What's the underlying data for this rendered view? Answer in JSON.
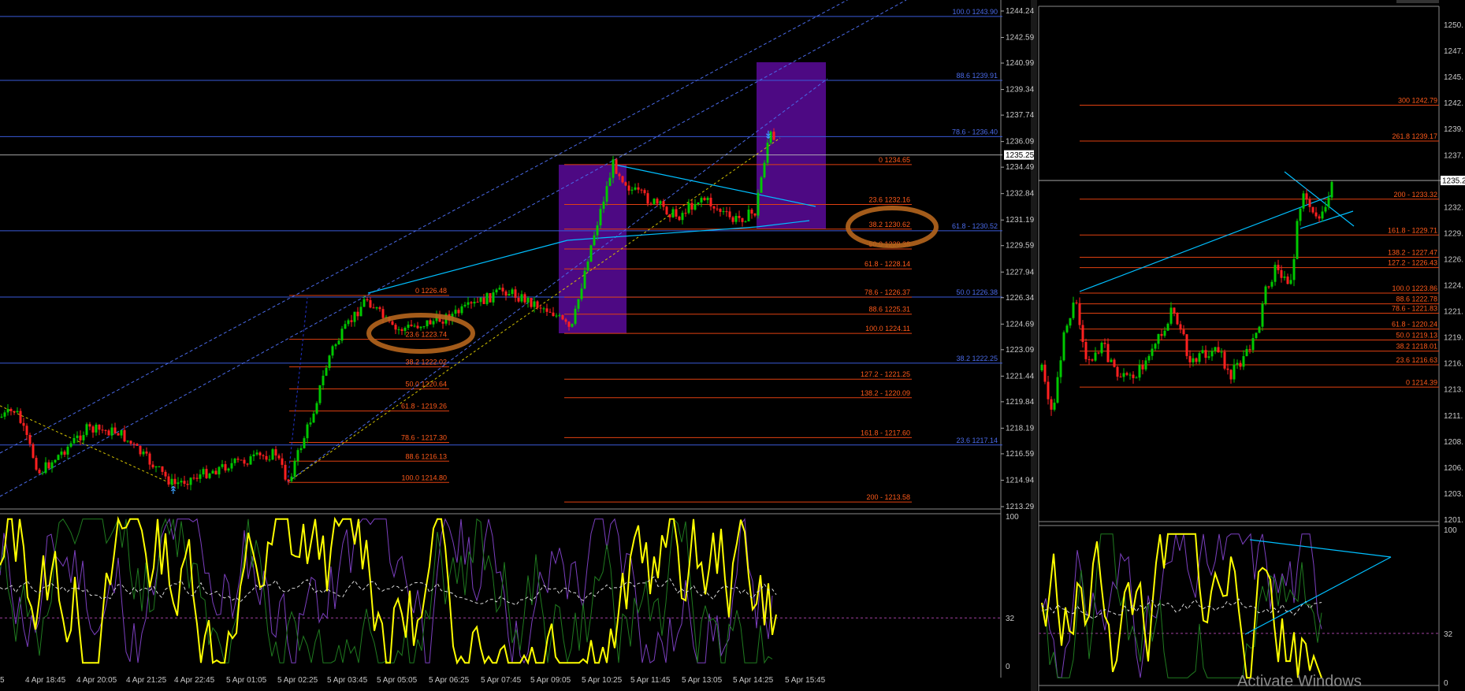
{
  "chart_data": [
    {
      "type": "candlestick",
      "panel": "main-left",
      "y_axis_ticks": [
        "1244.24",
        "1242.59",
        "1240.99",
        "1239.34",
        "1237.74",
        "1236.09",
        "1234.49",
        "1232.84",
        "1231.19",
        "1229.59",
        "1227.94",
        "1226.34",
        "1224.69",
        "1223.09",
        "1221.44",
        "1219.84",
        "1218.19",
        "1216.59",
        "1214.94",
        "1213.29"
      ],
      "ylim": [
        1213.29,
        1244.24
      ],
      "current_price": "1235.25",
      "x_axis_ticks": [
        "5",
        "4 Apr 18:45",
        "4 Apr 20:05",
        "4 Apr 21:25",
        "4 Apr 22:45",
        "5 Apr 01:05",
        "5 Apr 02:25",
        "5 Apr 03:45",
        "5 Apr 05:05",
        "5 Apr 06:25",
        "5 Apr 07:45",
        "5 Apr 09:05",
        "5 Apr 10:25",
        "5 Apr 11:45",
        "5 Apr 13:05",
        "5 Apr 14:25",
        "5 Apr 15:45"
      ],
      "blue_fib_levels": [
        {
          "label": "100.0 1243.90",
          "price": 1243.9
        },
        {
          "label": "88.6 1239.91",
          "price": 1239.91
        },
        {
          "label": "78.6 - 1236.40",
          "price": 1236.4
        },
        {
          "label": "61.8 - 1230.52",
          "price": 1230.52
        },
        {
          "label": "50.0 1226.38",
          "price": 1226.38
        },
        {
          "label": "38.2 1222.25",
          "price": 1222.25
        },
        {
          "label": "23.6 1217.14",
          "price": 1217.14
        }
      ],
      "red_fib_set_1": [
        {
          "label": "0 1226.48",
          "price": 1226.48
        },
        {
          "label": "23.6 1223.74",
          "price": 1223.74
        },
        {
          "label": "38.2 1222.02",
          "price": 1222.02
        },
        {
          "label": "50.0 1220.64",
          "price": 1220.64
        },
        {
          "label": "61.8 - 1219.26",
          "price": 1219.26
        },
        {
          "label": "78.6 - 1217.30",
          "price": 1217.3
        },
        {
          "label": "88.6 1216.13",
          "price": 1216.13
        },
        {
          "label": "100.0 1214.80",
          "price": 1214.8
        }
      ],
      "red_fib_set_2": [
        {
          "label": "0 1234.65",
          "price": 1234.65
        },
        {
          "label": "23.6 1232.16",
          "price": 1232.16
        },
        {
          "label": "38.2 1230.62",
          "price": 1230.62
        },
        {
          "label": "50.0 1229.38",
          "price": 1229.38
        },
        {
          "label": "61.8 - 1228.14",
          "price": 1228.14
        },
        {
          "label": "78.6 - 1226.37",
          "price": 1226.37
        },
        {
          "label": "88.6 1225.31",
          "price": 1225.31
        },
        {
          "label": "100.0 1224.11",
          "price": 1224.11
        },
        {
          "label": "127.2 - 1221.25",
          "price": 1221.25
        },
        {
          "label": "138.2 - 1220.09",
          "price": 1220.09
        },
        {
          "label": "161.8 - 1217.60",
          "price": 1217.6
        },
        {
          "label": "200 - 1213.58",
          "price": 1213.58
        }
      ],
      "colors": {
        "up": "#00c800",
        "down": "#ff2020",
        "fib_blue": "#3a5ad8",
        "fib_red": "#e04010",
        "trend": "#00bfff",
        "box": "#5a0a9a",
        "highlight": "#b5651d"
      }
    },
    {
      "type": "line",
      "panel": "oscillator-left",
      "y_axis_ticks": [
        "100",
        "32",
        "0"
      ],
      "ylim": [
        0,
        100
      ],
      "level": 32,
      "colors": {
        "main": "#ffff00",
        "signal": "#dcdcdc",
        "aux1": "#7b3fbf",
        "aux2": "#1f7a1f"
      }
    },
    {
      "type": "candlestick",
      "panel": "main-right",
      "y_axis_ticks": [
        "1250.",
        "1247.",
        "1245.",
        "1242.",
        "1239.",
        "1237.",
        "1234.",
        "1232.",
        "1229.",
        "1226.",
        "1224.",
        "1221.",
        "1219.",
        "1216.",
        "1213.",
        "1211.",
        "1208.",
        "1206.",
        "1203.",
        "1201."
      ],
      "ylim": [
        1201,
        1251
      ],
      "current_price": "1235.2",
      "red_fib_levels": [
        {
          "label": "300 1242.79",
          "price": 1242.79
        },
        {
          "label": "261.8 1239.17",
          "price": 1239.17
        },
        {
          "label": "200 - 1233.32",
          "price": 1233.32
        },
        {
          "label": "161.8 - 1229.71",
          "price": 1229.71
        },
        {
          "label": "138.2 - 1227.47",
          "price": 1227.47
        },
        {
          "label": "127.2 - 1226.43",
          "price": 1226.43
        },
        {
          "label": "100.0 1223.86",
          "price": 1223.86
        },
        {
          "label": "88.6 1222.78",
          "price": 1222.78
        },
        {
          "label": "78.6 - 1221.83",
          "price": 1221.83
        },
        {
          "label": "61.8 - 1220.24",
          "price": 1220.24
        },
        {
          "label": "50.0 1219.13",
          "price": 1219.13
        },
        {
          "label": "38.2 1218.01",
          "price": 1218.01
        },
        {
          "label": "23.6 1216.63",
          "price": 1216.63
        },
        {
          "label": "0 1214.39",
          "price": 1214.39
        }
      ]
    },
    {
      "type": "line",
      "panel": "oscillator-right",
      "y_axis_ticks": [
        "100",
        "32",
        "0"
      ],
      "ylim": [
        0,
        100
      ],
      "level": 32
    }
  ],
  "watermark": "Activate Windows"
}
